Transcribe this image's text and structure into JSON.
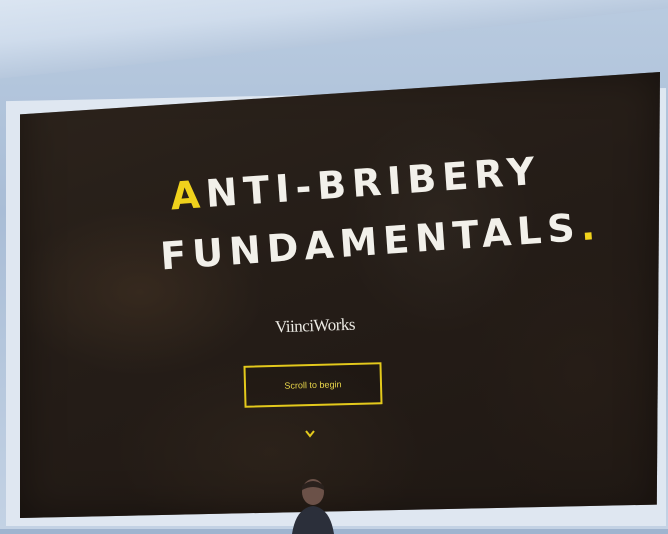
{
  "slide": {
    "title_line1_accent": "A",
    "title_line1_rest": "NTI-BRIBERY",
    "title_line2": "FUNDAMENTALS",
    "title_line2_dot": ".",
    "logo_text": "ViinciWorks",
    "begin_label": "Scroll to begin",
    "scroll_icon": "chevron-down-icon"
  },
  "colors": {
    "accent": "#f0d21c",
    "title_text": "#f2f0ea",
    "screen_bg": "#2e2520"
  }
}
